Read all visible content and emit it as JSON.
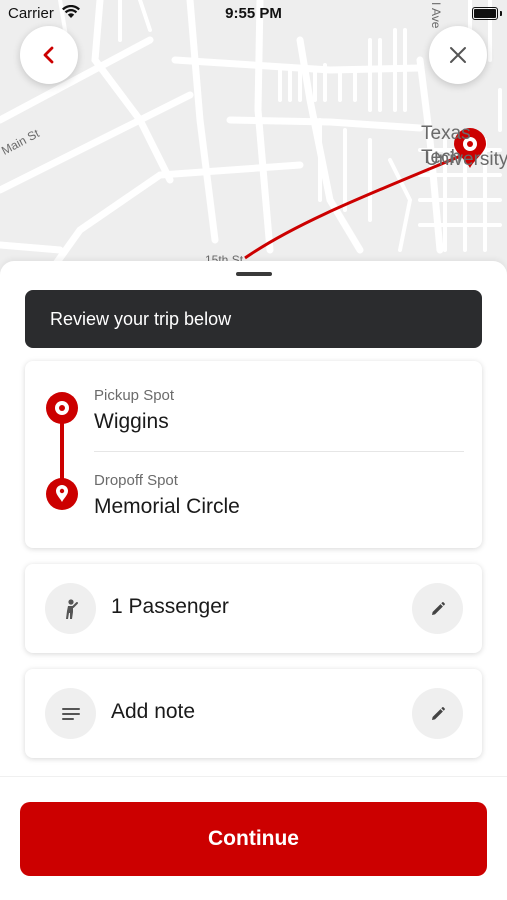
{
  "status_bar": {
    "carrier": "Carrier",
    "time": "9:55 PM"
  },
  "map": {
    "labels": {
      "street_main": "Main St",
      "street_15th": "15th St",
      "street_ave": "I Ave",
      "campus_line1": "Texas Tech",
      "campus_line2": "University"
    }
  },
  "nav": {
    "back_icon": "chevron-left-icon",
    "close_icon": "close-icon"
  },
  "banner": {
    "text": "Review your trip below"
  },
  "route": {
    "pickup_label": "Pickup Spot",
    "pickup_value": "Wiggins",
    "dropoff_label": "Dropoff Spot",
    "dropoff_value": "Memorial Circle"
  },
  "passengers": {
    "text": "1 Passenger",
    "icon": "person-icon",
    "edit_icon": "pencil-icon"
  },
  "note": {
    "text": "Add note",
    "icon": "notes-icon",
    "edit_icon": "pencil-icon"
  },
  "continue_button": {
    "label": "Continue"
  },
  "colors": {
    "accent": "#CC0000",
    "banner_bg": "#2B2C2E",
    "map_bg": "#EEEEEE"
  }
}
